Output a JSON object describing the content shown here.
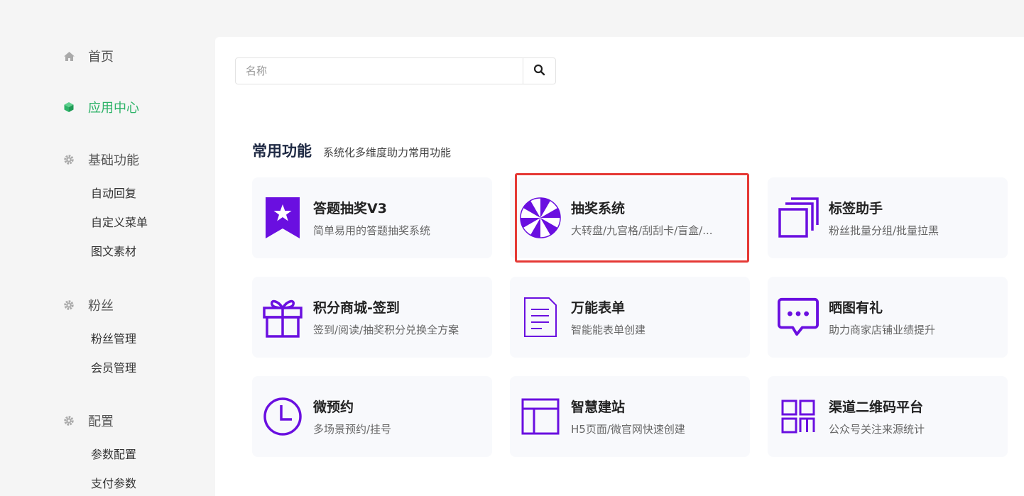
{
  "colors": {
    "accent": "#2db368",
    "icon": "#6a0fe0",
    "highlight": "#e53935"
  },
  "sidebar": {
    "home": {
      "label": "首页",
      "icon": "home-icon"
    },
    "app_center": {
      "label": "应用中心",
      "icon": "cube-icon"
    },
    "basic": {
      "label": "基础功能",
      "icon": "gear-icon",
      "items": [
        "自动回复",
        "自定义菜单",
        "图文素材"
      ]
    },
    "fans": {
      "label": "粉丝",
      "icon": "gear-icon",
      "items": [
        "粉丝管理",
        "会员管理"
      ]
    },
    "config": {
      "label": "配置",
      "icon": "gear-icon",
      "items": [
        "参数配置",
        "支付参数"
      ]
    }
  },
  "search": {
    "placeholder": "名称",
    "value": ""
  },
  "section": {
    "title": "常用功能",
    "subtitle": "系统化多维度助力常用功能"
  },
  "cards": [
    {
      "name": "答题抽奖V3",
      "desc": "简单易用的答题抽奖系统",
      "icon": "ribbon-star-icon"
    },
    {
      "name": "抽奖系统",
      "desc": "大转盘/九宫格/刮刮卡/盲盒/...",
      "icon": "wheel-icon"
    },
    {
      "name": "标签助手",
      "desc": "粉丝批量分组/批量拉黑",
      "icon": "stacked-squares-icon"
    },
    {
      "name": "积分商城-签到",
      "desc": "签到/阅读/抽奖积分兑换全方案",
      "icon": "gift-icon"
    },
    {
      "name": "万能表单",
      "desc": "智能能表单创建",
      "icon": "document-icon"
    },
    {
      "name": "晒图有礼",
      "desc": "助力商家店铺业绩提升",
      "icon": "chat-bubble-icon"
    },
    {
      "name": "微预约",
      "desc": "多场景预约/挂号",
      "icon": "clock-icon"
    },
    {
      "name": "智慧建站",
      "desc": "H5页面/微官网快速创建",
      "icon": "layout-icon"
    },
    {
      "name": "渠道二维码平台",
      "desc": "公众号关注来源统计",
      "icon": "grid-icon"
    }
  ]
}
